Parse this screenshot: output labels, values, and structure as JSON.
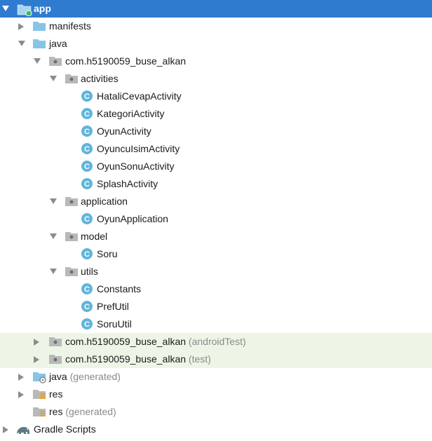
{
  "colors": {
    "selection": "#2f7bd0",
    "test_sources_bg": "#edf6e6",
    "folder": "#86c5e6",
    "class_icon": "#5fb6da"
  },
  "tree": {
    "app": {
      "label": "app",
      "icon": "module-folder-icon"
    },
    "manifests": {
      "label": "manifests",
      "icon": "folder-icon"
    },
    "java": {
      "label": "java",
      "icon": "folder-icon"
    },
    "pkg_main": {
      "label": "com.h5190059_buse_alkan",
      "icon": "package-icon"
    },
    "activities": {
      "label": "activities",
      "icon": "package-icon"
    },
    "classes_activities": [
      {
        "label": "HataliCevapActivity"
      },
      {
        "label": "KategoriActivity"
      },
      {
        "label": "OyunActivity"
      },
      {
        "label": "OyuncuIsimActivity"
      },
      {
        "label": "OyunSonuActivity"
      },
      {
        "label": "SplashActivity"
      }
    ],
    "application": {
      "label": "application",
      "icon": "package-icon"
    },
    "classes_application": [
      {
        "label": "OyunApplication"
      }
    ],
    "model": {
      "label": "model",
      "icon": "package-icon"
    },
    "classes_model": [
      {
        "label": "Soru"
      }
    ],
    "utils": {
      "label": "utils",
      "icon": "package-icon"
    },
    "classes_utils": [
      {
        "label": "Constants"
      },
      {
        "label": "PrefUtil"
      },
      {
        "label": "SoruUtil"
      }
    ],
    "pkg_android_test": {
      "label": "com.h5190059_buse_alkan",
      "suffix": "(androidTest)"
    },
    "pkg_test": {
      "label": "com.h5190059_buse_alkan",
      "suffix": "(test)"
    },
    "java_generated": {
      "label": "java",
      "suffix": "(generated)"
    },
    "res": {
      "label": "res"
    },
    "res_generated": {
      "label": "res",
      "suffix": "(generated)"
    },
    "gradle_scripts": {
      "label": "Gradle Scripts"
    }
  }
}
